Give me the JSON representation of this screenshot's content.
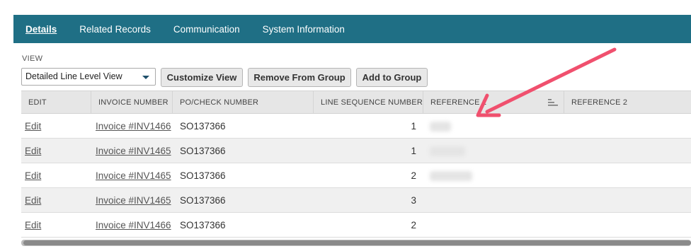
{
  "tabs": [
    {
      "label": "Details",
      "active": true
    },
    {
      "label": "Related Records",
      "active": false
    },
    {
      "label": "Communication",
      "active": false
    },
    {
      "label": "System Information",
      "active": false
    }
  ],
  "view": {
    "label": "VIEW",
    "selected": "Detailed Line Level View"
  },
  "buttons": {
    "customize": "Customize View",
    "remove": "Remove From Group",
    "add": "Add to Group"
  },
  "columns": [
    "EDIT",
    "INVOICE NUMBER",
    "PO/CHECK NUMBER",
    "LINE SEQUENCE NUMBER",
    "REFERENCE 1",
    "REFERENCE 2"
  ],
  "rows": [
    {
      "edit": "Edit",
      "invoice": "Invoice #INV1466",
      "po": "SO137366",
      "seq": "1"
    },
    {
      "edit": "Edit",
      "invoice": "Invoice #INV1465",
      "po": "SO137366",
      "seq": "1"
    },
    {
      "edit": "Edit",
      "invoice": "Invoice #INV1465",
      "po": "SO137366",
      "seq": "2"
    },
    {
      "edit": "Edit",
      "invoice": "Invoice #INV1465",
      "po": "SO137366",
      "seq": "3"
    },
    {
      "edit": "Edit",
      "invoice": "Invoice #INV1466",
      "po": "SO137366",
      "seq": "2"
    }
  ],
  "colors": {
    "tabbar": "#1f6f85",
    "arrow": "#f0506e"
  },
  "icons": {
    "sort": "sort-lines-icon",
    "caret": "caret-down-icon"
  }
}
